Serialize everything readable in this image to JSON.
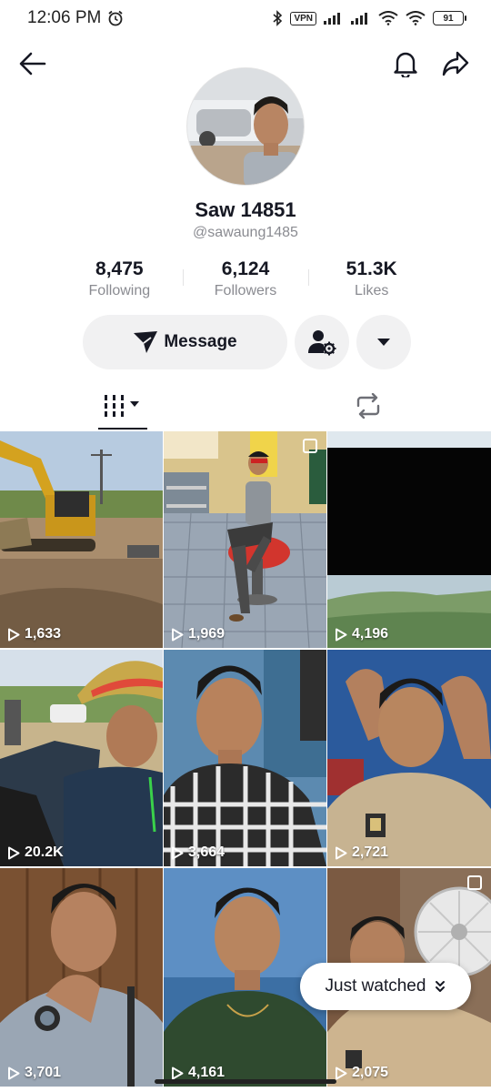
{
  "status_bar": {
    "time": "12:06 PM",
    "vpn": "VPN",
    "battery": "91"
  },
  "profile": {
    "display_name": "Saw 14851",
    "handle": "@sawaung1485",
    "stats": [
      {
        "value": "8,475",
        "label": "Following"
      },
      {
        "value": "6,124",
        "label": "Followers"
      },
      {
        "value": "51.3K",
        "label": "Likes"
      }
    ],
    "message_label": "Message"
  },
  "videos": [
    {
      "views": "1,633",
      "multi": false
    },
    {
      "views": "1,969",
      "multi": true
    },
    {
      "views": "4,196",
      "multi": false
    },
    {
      "views": "20.2K",
      "multi": false
    },
    {
      "views": "3,664",
      "multi": false
    },
    {
      "views": "2,721",
      "multi": false
    },
    {
      "views": "3,701",
      "multi": false
    },
    {
      "views": "4,161",
      "multi": false
    },
    {
      "views": "2,075",
      "multi": true
    }
  ],
  "just_watched_label": "Just watched",
  "colors": {
    "text": "#161823",
    "secondary": "#8a8b91",
    "button_bg": "#f1f1f2"
  },
  "icons": [
    "back-arrow-icon",
    "bell-icon",
    "share-icon",
    "send-icon",
    "person-settings-icon",
    "caret-down-icon",
    "grid-icon",
    "repost-icon",
    "play-icon",
    "double-chevron-down-icon"
  ]
}
